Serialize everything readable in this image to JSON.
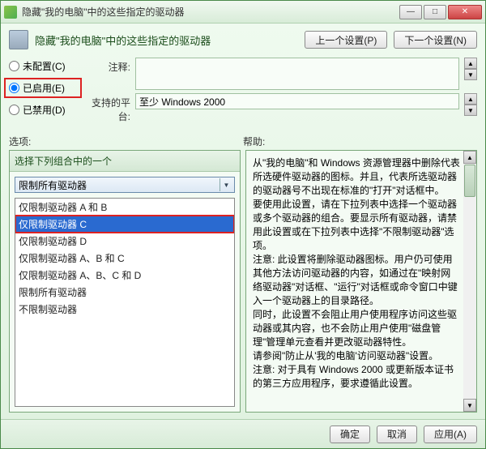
{
  "titlebar": {
    "title": "隐藏\"我的电脑\"中的这些指定的驱动器"
  },
  "header": {
    "title": "隐藏\"我的电脑\"中的这些指定的驱动器",
    "prev_btn": "上一个设置(P)",
    "next_btn": "下一个设置(N)"
  },
  "radios": {
    "not_configured": "未配置(C)",
    "enabled": "已启用(E)",
    "disabled": "已禁用(D)"
  },
  "comments_label": "注释:",
  "platform_label": "支持的平台:",
  "platform_value": "至少 Windows 2000",
  "options_label": "选项:",
  "help_label": "帮助:",
  "left_panel": {
    "header": "选择下列组合中的一个",
    "combo_value": "限制所有驱动器",
    "items": [
      "仅限制驱动器 A 和 B",
      "仅限制驱动器 C",
      "仅限制驱动器 D",
      "仅限制驱动器 A、B 和 C",
      "仅限制驱动器 A、B、C 和 D",
      "限制所有驱动器",
      "不限制驱动器"
    ],
    "selected_index": 1
  },
  "help_text": {
    "p1": "从\"我的电脑\"和 Windows 资源管理器中删除代表所选硬件驱动器的图标。并且，代表所选驱动器的驱动器号不出现在标准的\"打开\"对话框中。",
    "p2": "要使用此设置，请在下拉列表中选择一个驱动器或多个驱动器的组合。要显示所有驱动器，请禁用此设置或在下拉列表中选择\"不限制驱动器\"选项。",
    "p3": "注意: 此设置将删除驱动器图标。用户仍可使用其他方法访问驱动器的内容，如通过在\"映射网络驱动器\"对话框、\"运行\"对话框或命令窗口中键入一个驱动器上的目录路径。",
    "p4": "同时，此设置不会阻止用户使用程序访问这些驱动器或其内容，也不会防止用户使用\"磁盘管理\"管理单元查看并更改驱动器特性。",
    "p5": "请参阅\"防止从'我的电脑'访问驱动器\"设置。",
    "p6": "注意: 对于具有 Windows 2000 或更新版本证书的第三方应用程序，要求遵循此设置。"
  },
  "footer": {
    "ok": "确定",
    "cancel": "取消",
    "apply": "应用(A)"
  }
}
